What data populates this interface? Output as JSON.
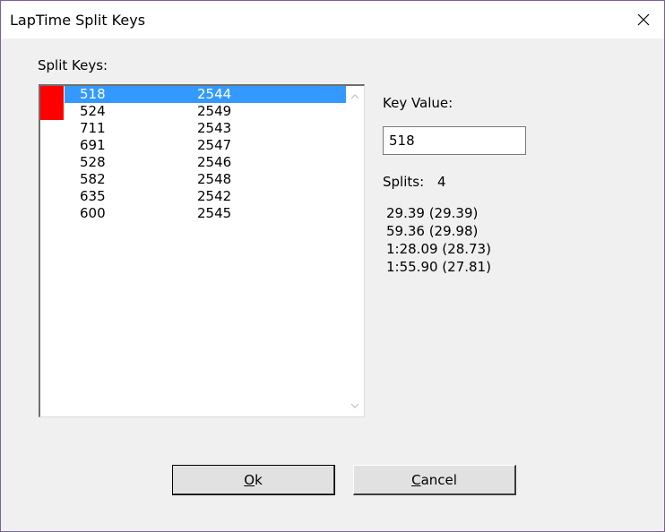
{
  "window": {
    "title": "LapTime Split Keys"
  },
  "split_keys_label": "Split Keys:",
  "list": {
    "rows": [
      {
        "key": "518",
        "value": "2544",
        "selected": true,
        "marked": true
      },
      {
        "key": "524",
        "value": "2549",
        "selected": false,
        "marked": true
      },
      {
        "key": "711",
        "value": "2543",
        "selected": false,
        "marked": false
      },
      {
        "key": "691",
        "value": "2547",
        "selected": false,
        "marked": false
      },
      {
        "key": "528",
        "value": "2546",
        "selected": false,
        "marked": false
      },
      {
        "key": "582",
        "value": "2548",
        "selected": false,
        "marked": false
      },
      {
        "key": "635",
        "value": "2542",
        "selected": false,
        "marked": false
      },
      {
        "key": "600",
        "value": "2545",
        "selected": false,
        "marked": false
      }
    ]
  },
  "key_value": {
    "label": "Key Value:",
    "value": "518"
  },
  "splits": {
    "label": "Splits:",
    "count": "4",
    "times": [
      "29.39 (29.39)",
      "59.36 (29.98)",
      "1:28.09 (28.73)",
      "1:55.90 (27.81)"
    ]
  },
  "buttons": {
    "ok": "Ok",
    "cancel": "Cancel"
  },
  "colors": {
    "selection": "#3399ff",
    "marker": "#ff0000"
  },
  "icons": {
    "close": "close-icon",
    "scroll_up": "chevron-up-icon",
    "scroll_down": "chevron-down-icon"
  }
}
